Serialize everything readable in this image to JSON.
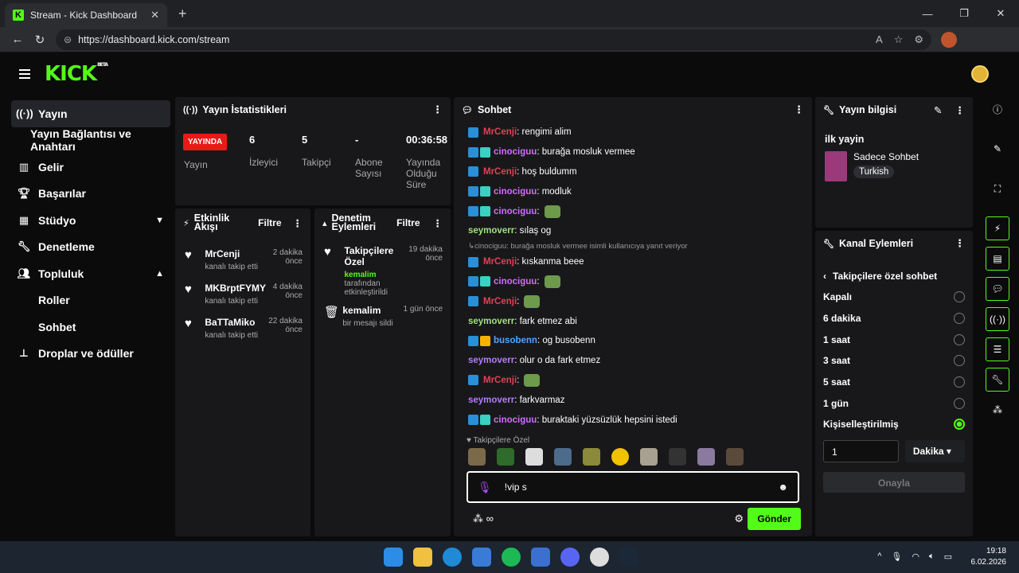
{
  "browser": {
    "tab_title": "Stream - Kick Dashboard",
    "tab_favicon": "K",
    "url": "https://dashboard.kick.com/stream"
  },
  "brand": {
    "logo": "KICK",
    "logo_sup": "BETA",
    "accent": "#53fc18"
  },
  "sidebar": {
    "items": [
      {
        "label": "Yayın",
        "icon": "broadcast-icon"
      },
      {
        "label": "Yayın Bağlantısı ve Anahtarı"
      },
      {
        "label": "Gelir",
        "icon": "chart-icon"
      },
      {
        "label": "Başarılar",
        "icon": "trophy-icon"
      },
      {
        "label": "Stüdyo",
        "icon": "studio-icon"
      },
      {
        "label": "Denetleme",
        "icon": "wrench-icon"
      },
      {
        "label": "Topluluk",
        "icon": "people-icon"
      },
      {
        "label": "Roller"
      },
      {
        "label": "Sohbet"
      },
      {
        "label": "Droplar ve ödüller",
        "icon": "drops-icon"
      }
    ]
  },
  "stats": {
    "title": "Yayın İstatistikleri",
    "live_label": "YAYINDA",
    "live_sub": "Yayın",
    "viewers_value": "6",
    "viewers_label": "İzleyici",
    "followers_value": "5",
    "followers_label": "Takipçi",
    "subs_value": "-",
    "subs_label": "Abone Sayısı",
    "duration_value": "00:36:58",
    "duration_label": "Yayında Olduğu Süre"
  },
  "activity": {
    "title": "Etkinlik Akışı",
    "filter": "Filtre",
    "items": [
      {
        "name": "MrCenji",
        "sub": "kanalı takip etti",
        "time": "2 dakika önce"
      },
      {
        "name": "MKBrptFYMY",
        "sub": "kanalı takip etti",
        "time": "4 dakika önce"
      },
      {
        "name": "BaTTaMiko",
        "sub": "kanalı takip etti",
        "time": "22 dakika önce"
      }
    ]
  },
  "moderation": {
    "title": "Denetim Eylemleri",
    "filter": "Filtre",
    "items": [
      {
        "title": "Takipçilere Özel",
        "user": "kemalim",
        "sub": "tarafından etkinleştirildi",
        "time": "19 dakika önce"
      },
      {
        "title": "kemalim",
        "sub": "bir mesajı sildi",
        "time": "1 gün önce"
      }
    ]
  },
  "chat": {
    "title": "Sohbet",
    "messages": [
      {
        "user": "MrCenji",
        "text": ": rengimi alim"
      },
      {
        "user": "cinociguu",
        "text": ": burağa mosluk vermee"
      },
      {
        "user": "MrCenji",
        "text": ": hoş buldumm"
      },
      {
        "user": "cinociguu",
        "text": ": modluk"
      },
      {
        "user": "cinociguu",
        "text": ":"
      },
      {
        "user": "seymoverr",
        "text": ": sılaş og"
      },
      {
        "user": "MrCenji",
        "text": ": kıskanma beee"
      },
      {
        "user": "cinociguu",
        "text": ":"
      },
      {
        "user": "MrCenji",
        "text": ":"
      },
      {
        "user": "seymoverr",
        "text": ": fark etmez abi"
      },
      {
        "user": "busobenn",
        "text": ": og busobenn"
      },
      {
        "user": "seymoverr",
        "text": ": olur o da fark etmez"
      },
      {
        "user": "MrCenji",
        "text": ":"
      },
      {
        "user": "seymoverr",
        "text": ": farkvarmaz"
      },
      {
        "user": "cinociguu",
        "text": ": buraktaki yüzsüzlük hepsini istedi"
      }
    ],
    "reply_note": "cinociguu: burağa mosluk vermee isimli kullanıcıya yanıt veriyor",
    "emote_section": "Takipçilere Özel",
    "input_value": "!vip s",
    "send_label": "Gönder"
  },
  "info": {
    "title": "Yayın bilgisi",
    "stream_title": "ilk yayin",
    "category": "Sadece Sohbet",
    "language": "Turkish"
  },
  "channel_actions": {
    "title": "Kanal Eylemleri",
    "subtitle": "Takipçilere özel sohbet",
    "options": [
      "Kapalı",
      "6 dakika",
      "1 saat",
      "3 saat",
      "5 saat",
      "1 gün",
      "Kişiselleştirilmiş"
    ],
    "custom_value": "1",
    "unit": "Dakika",
    "confirm": "Onayla"
  },
  "taskbar": {
    "time": "19:18",
    "date": "6.02.2026"
  }
}
